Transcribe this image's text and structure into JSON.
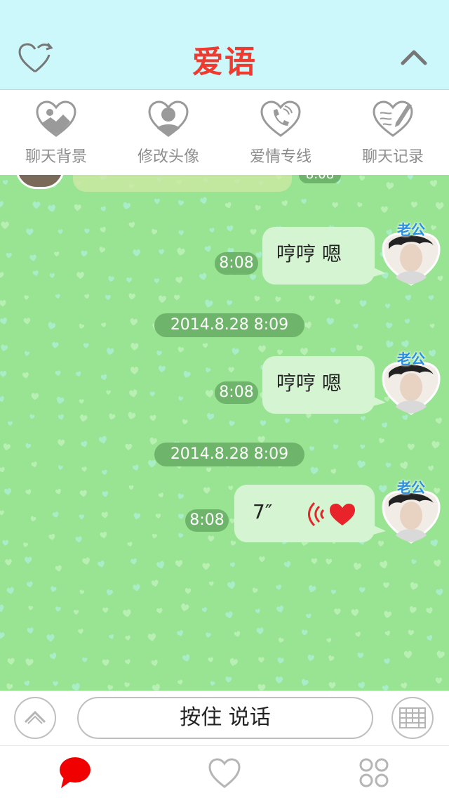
{
  "header": {
    "title": "爱语",
    "left_icon": "heart-refresh-icon",
    "right_icon": "chevron-up-icon"
  },
  "toolbar": {
    "items": [
      {
        "label": "聊天背景",
        "icon": "heart-landscape-icon"
      },
      {
        "label": "修改头像",
        "icon": "heart-person-icon"
      },
      {
        "label": "爱情专线",
        "icon": "heart-phone-icon"
      },
      {
        "label": "聊天记录",
        "icon": "heart-pencil-icon"
      }
    ]
  },
  "chat": {
    "top_partial_time": "8:08",
    "messages": [
      {
        "type": "text",
        "text": "哼哼 嗯",
        "time": "8:08",
        "avatar_tag": "老公"
      },
      {
        "type": "date",
        "text": "2014.8.28 8:09"
      },
      {
        "type": "text",
        "text": "哼哼 嗯",
        "time": "8:08",
        "avatar_tag": "老公"
      },
      {
        "type": "date",
        "text": "2014.8.28 8:09"
      },
      {
        "type": "voice",
        "text": "7″",
        "time": "8:08",
        "avatar_tag": "老公"
      }
    ]
  },
  "input": {
    "talk_label": "按住 说话",
    "left_icon": "chevron-up-circle-icon",
    "right_icon": "keyboard-icon"
  },
  "bottom_nav": {
    "items": [
      {
        "icon": "chat-bubble-icon",
        "active": true
      },
      {
        "icon": "heart-icon",
        "active": false
      },
      {
        "icon": "grid-circles-icon",
        "active": false
      }
    ]
  },
  "colors": {
    "accent": "#f03a2f",
    "header_bg": "#ccf8fb",
    "chat_bg": "#98e492",
    "bubble": "#d5f5d2",
    "time_pill": "#6fb46b"
  }
}
